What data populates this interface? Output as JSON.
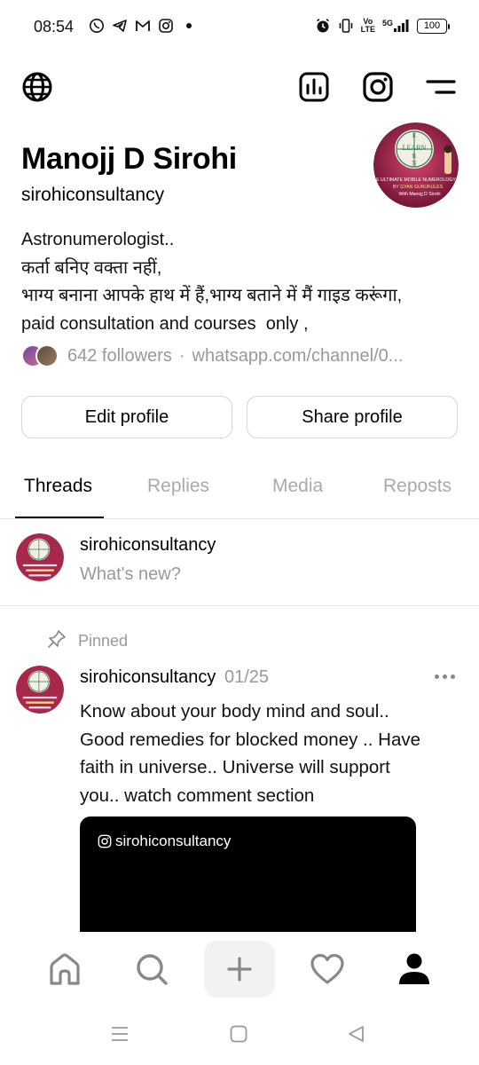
{
  "status_bar": {
    "time": "08:54",
    "left_icons": [
      "whatsapp-icon",
      "telegram-icon",
      "gmail-icon",
      "instagram-icon",
      "dot-icon"
    ],
    "right_icons": [
      "alarm-icon",
      "vibrate-icon",
      "volte-icon",
      "signal-5g-icon",
      "battery-icon"
    ],
    "volte_top": "Vo",
    "volte_bottom": "LTE",
    "net_label": "5G",
    "battery": "100"
  },
  "top_bar": {
    "icons": [
      "globe-icon",
      "insights-icon",
      "instagram-icon",
      "menu-icon"
    ]
  },
  "profile": {
    "name": "Manojj D Sirohi",
    "handle": "sirohiconsultancy",
    "bio_lines": [
      "Astronumerologist..",
      "कर्ता बनिए वक्ता नहीं,",
      "भाग्य बनाना आपके हाथ में हैं,भाग्य बताने में मैं गाइड करूंगा,",
      "paid consultation and courses  only ,"
    ],
    "followers": "642 followers",
    "separator": "·",
    "link": "whatsapp.com/channel/0...",
    "avatar_text": {
      "letters": [
        "E",
        "LEARN",
        "R",
        "N"
      ],
      "line1": "E ULTIMATE MOBILE NUMEROLOGY",
      "line2": "BY GYAN GURUKULES",
      "line3": "With Manojj D Sirohi"
    }
  },
  "buttons": {
    "edit": "Edit profile",
    "share": "Share profile"
  },
  "tabs": [
    {
      "label": "Threads",
      "active": true
    },
    {
      "label": "Replies",
      "active": false
    },
    {
      "label": "Media",
      "active": false
    },
    {
      "label": "Reposts",
      "active": false
    }
  ],
  "composer": {
    "username": "sirohiconsultancy",
    "placeholder": "What's new?"
  },
  "post": {
    "pinned_label": "Pinned",
    "username": "sirohiconsultancy",
    "date": "01/25",
    "text_lines": [
      "Know about your body mind and soul..",
      "Good remedies for blocked money .. Have",
      "faith in universe.. Universe will support",
      "you.. watch comment section"
    ],
    "media_caption": "sirohiconsultancy"
  },
  "bottom_nav": {
    "items": [
      "home-icon",
      "search-icon",
      "compose-icon",
      "heart-icon",
      "profile-icon"
    ]
  },
  "system_nav": {
    "items": [
      "recents-icon",
      "home-square-icon",
      "back-icon"
    ]
  },
  "colors": {
    "primary_text": "#000000",
    "secondary_text": "#999999",
    "divider": "#e5e5e5",
    "avatar_bg": "#b0304f"
  }
}
